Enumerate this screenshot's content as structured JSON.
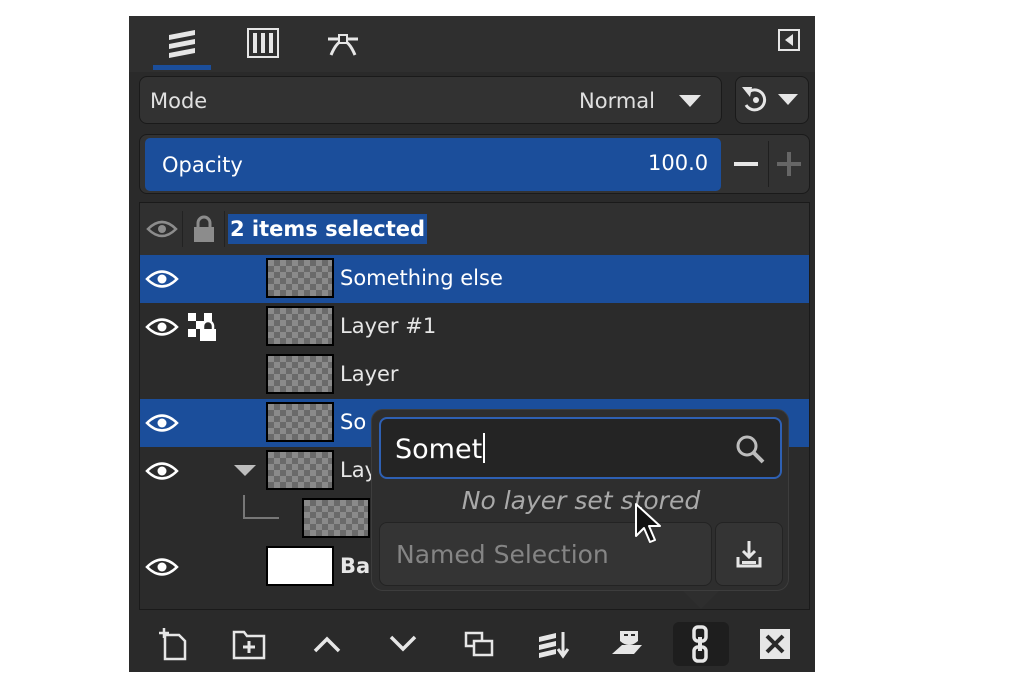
{
  "tabs": [
    {
      "name": "layers-icon",
      "active": true
    },
    {
      "name": "channels-icon",
      "active": false
    },
    {
      "name": "paths-icon",
      "active": false
    }
  ],
  "mode": {
    "label": "Mode",
    "value": "Normal"
  },
  "opacity": {
    "label": "Opacity",
    "value": "100.0",
    "level_percent": 100
  },
  "header": {
    "selection_label": "2 items selected"
  },
  "layers": [
    {
      "name": "Something else",
      "selected": true,
      "visible": true
    },
    {
      "name": "Layer #1",
      "selected": false,
      "visible": true,
      "locked": true
    },
    {
      "name": "Layer",
      "selected": false,
      "visible": false
    },
    {
      "name": "So",
      "selected": true,
      "visible": true
    },
    {
      "name": "Lay",
      "selected": false,
      "visible": true,
      "expanded": true
    },
    {
      "name": "",
      "selected": false,
      "visible": false,
      "child": true
    },
    {
      "name": "Bac",
      "selected": false,
      "visible": true,
      "bold": true
    }
  ],
  "popover": {
    "search_value": "Somet",
    "empty_message": "No layer set stored",
    "named_selection_placeholder": "Named Selection"
  },
  "bottom_bar": [
    "new-layer-icon",
    "new-group-icon",
    "raise-layer-icon",
    "lower-layer-icon",
    "duplicate-layer-icon",
    "merge-down-icon",
    "mask-icon",
    "link-chain-icon",
    "delete-layer-icon"
  ],
  "colors": {
    "accent": "#1b4e9b",
    "panel": "#2a2a2a",
    "text": "#e6e6e6"
  }
}
